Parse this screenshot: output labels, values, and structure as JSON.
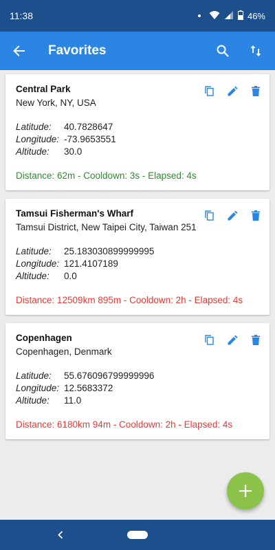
{
  "status": {
    "time": "11:38",
    "battery": "46%"
  },
  "appbar": {
    "title": "Favorites"
  },
  "favorites": [
    {
      "name": "Central Park",
      "address": "New York, NY, USA",
      "labels": {
        "lat": "Latitude:",
        "lon": "Longitude:",
        "alt": "Altitude:"
      },
      "latitude": "40.7828647",
      "longitude": "-73.9653551",
      "altitude": "30.0",
      "distance": "Distance: 62m - Cooldown: 3s - Elapsed: 4s",
      "distance_color": "#2e8b2e"
    },
    {
      "name": "Tamsui Fisherman's Wharf",
      "address": "Tamsui District, New Taipei City, Taiwan 251",
      "labels": {
        "lat": "Latitude:",
        "lon": "Longitude:",
        "alt": "Altitude:"
      },
      "latitude": "25.183030899999995",
      "longitude": "121.4107189",
      "altitude": "0.0",
      "distance": "Distance: 12509km 895m - Cooldown: 2h - Elapsed: 4s",
      "distance_color": "#e53935"
    },
    {
      "name": "Copenhagen",
      "address": "Copenhagen, Denmark",
      "labels": {
        "lat": "Latitude:",
        "lon": "Longitude:",
        "alt": "Altitude:"
      },
      "latitude": "55.676096799999996",
      "longitude": "12.5683372",
      "altitude": "11.0",
      "distance": "Distance: 6180km 94m - Cooldown: 2h - Elapsed: 4s",
      "distance_color": "#e53935"
    }
  ],
  "icons": {
    "back": "arrow-back-icon",
    "search": "search-icon",
    "sort": "sort-icon",
    "copy": "copy-icon",
    "edit": "edit-icon",
    "delete": "delete-icon",
    "add": "add-icon"
  },
  "colors": {
    "status_bar": "#1c4f8c",
    "app_bar": "#2b86e3",
    "action_icon": "#2b86e3",
    "fab": "#8bc34a"
  }
}
